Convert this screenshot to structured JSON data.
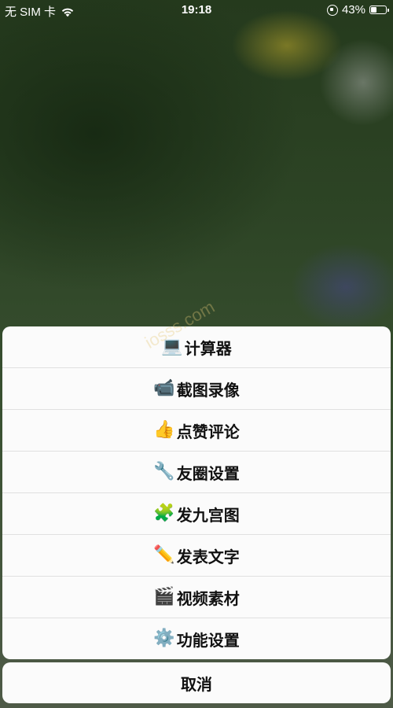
{
  "status_bar": {
    "carrier": "无 SIM 卡",
    "time": "19:18",
    "battery": "43%"
  },
  "menu": {
    "items": [
      {
        "icon": "💻",
        "icon_name": "laptop-icon",
        "label": "计算器"
      },
      {
        "icon": "📹",
        "icon_name": "video-camera-icon",
        "label": "截图录像"
      },
      {
        "icon": "👍",
        "icon_name": "thumbs-up-icon",
        "label": "点赞评论"
      },
      {
        "icon": "🔧",
        "icon_name": "wrench-icon",
        "label": "友圈设置"
      },
      {
        "icon": "🧩",
        "icon_name": "puzzle-icon",
        "label": "发九宫图"
      },
      {
        "icon": "✏️",
        "icon_name": "pencil-icon",
        "label": "发表文字"
      },
      {
        "icon": "🎬",
        "icon_name": "clapper-board-icon",
        "label": "视频素材"
      },
      {
        "icon": "⚙️",
        "icon_name": "gear-icon",
        "label": "功能设置"
      }
    ],
    "cancel_label": "取消"
  },
  "watermark": "iosss.com",
  "colors": {
    "sheet_background": "#fbfbfb",
    "separator": "#e0e0e0",
    "text": "#111111"
  }
}
